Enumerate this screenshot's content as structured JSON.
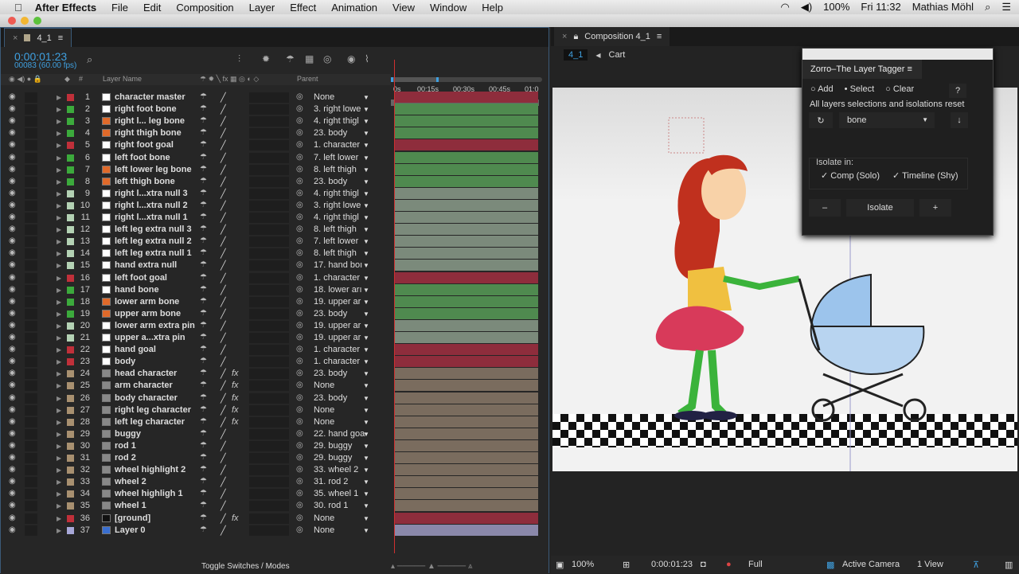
{
  "menubar": {
    "app": "After Effects",
    "items": [
      "File",
      "Edit",
      "Composition",
      "Layer",
      "Effect",
      "Animation",
      "View",
      "Window",
      "Help"
    ],
    "battery": "100%",
    "clock": "Fri 11:32",
    "user": "Mathias Möhl"
  },
  "timeline": {
    "tab": "4_1",
    "timecode": "0:00:01:23",
    "frames": "00083 (60.00 fps)",
    "columns": {
      "layer_name": "Layer Name",
      "parent": "Parent",
      "num": "#"
    },
    "ruler": [
      "0s",
      "00:15s",
      "00:30s",
      "00:45s",
      "01:0"
    ],
    "footer": "Toggle Switches / Modes",
    "colors": {
      "red": "#8e2d3c",
      "green": "#4f8a4f",
      "gray": "#7b8a7b",
      "tan": "#7a6c5e",
      "lavender": "#8a88aa"
    },
    "layers": [
      {
        "n": "1",
        "name": "character master",
        "lc": "#c0303a",
        "ic": "solid",
        "fx": false,
        "parent": "None",
        "bar": "red"
      },
      {
        "n": "2",
        "name": "right foot bone",
        "lc": "#3caa3c",
        "ic": "solid",
        "fx": false,
        "parent": "3. right lowe",
        "bar": "green"
      },
      {
        "n": "3",
        "name": "right l... leg bone",
        "lc": "#3caa3c",
        "ic": "bone",
        "fx": false,
        "parent": "4. right thigl",
        "bar": "green"
      },
      {
        "n": "4",
        "name": "right thigh bone",
        "lc": "#3caa3c",
        "ic": "bone",
        "fx": false,
        "parent": "23. body",
        "bar": "green"
      },
      {
        "n": "5",
        "name": "right foot goal",
        "lc": "#c0303a",
        "ic": "solid",
        "fx": false,
        "parent": "1. character",
        "bar": "red"
      },
      {
        "n": "6",
        "name": "left foot bone",
        "lc": "#3caa3c",
        "ic": "solid",
        "fx": false,
        "parent": "7. left lower",
        "bar": "green"
      },
      {
        "n": "7",
        "name": "left lower leg bone",
        "lc": "#3caa3c",
        "ic": "bone",
        "fx": false,
        "parent": "8. left thigh",
        "bar": "green"
      },
      {
        "n": "8",
        "name": "left thigh bone",
        "lc": "#3caa3c",
        "ic": "bone",
        "fx": false,
        "parent": "23. body",
        "bar": "green"
      },
      {
        "n": "9",
        "name": "right l...xtra null 3",
        "lc": "#b4d2b4",
        "ic": "solid",
        "fx": false,
        "parent": "4. right thigl",
        "bar": "gray"
      },
      {
        "n": "10",
        "name": "right l...xtra null 2",
        "lc": "#b4d2b4",
        "ic": "solid",
        "fx": false,
        "parent": "3. right lowe",
        "bar": "gray"
      },
      {
        "n": "11",
        "name": "right l...xtra null 1",
        "lc": "#b4d2b4",
        "ic": "solid",
        "fx": false,
        "parent": "4. right thigl",
        "bar": "gray"
      },
      {
        "n": "12",
        "name": "left leg extra null 3",
        "lc": "#b4d2b4",
        "ic": "solid",
        "fx": false,
        "parent": "8. left thigh",
        "bar": "gray"
      },
      {
        "n": "13",
        "name": "left leg extra null 2",
        "lc": "#b4d2b4",
        "ic": "solid",
        "fx": false,
        "parent": "7. left lower",
        "bar": "gray"
      },
      {
        "n": "14",
        "name": "left leg extra null 1",
        "lc": "#b4d2b4",
        "ic": "solid",
        "fx": false,
        "parent": "8. left thigh",
        "bar": "gray"
      },
      {
        "n": "15",
        "name": "hand extra null",
        "lc": "#b4d2b4",
        "ic": "solid",
        "fx": false,
        "parent": "17. hand boı",
        "bar": "gray"
      },
      {
        "n": "16",
        "name": "left foot goal",
        "lc": "#c0303a",
        "ic": "solid",
        "fx": false,
        "parent": "1. character",
        "bar": "red"
      },
      {
        "n": "17",
        "name": "hand bone",
        "lc": "#3caa3c",
        "ic": "solid",
        "fx": false,
        "parent": "18. lower arı",
        "bar": "green"
      },
      {
        "n": "18",
        "name": "lower arm bone",
        "lc": "#3caa3c",
        "ic": "bone",
        "fx": false,
        "parent": "19. upper ar",
        "bar": "green"
      },
      {
        "n": "19",
        "name": "upper arm bone",
        "lc": "#3caa3c",
        "ic": "bone",
        "fx": false,
        "parent": "23. body",
        "bar": "green"
      },
      {
        "n": "20",
        "name": "lower arm extra pin",
        "lc": "#b4d2b4",
        "ic": "solid",
        "fx": false,
        "parent": "19. upper ar",
        "bar": "gray"
      },
      {
        "n": "21",
        "name": "upper a...xtra pin",
        "lc": "#b4d2b4",
        "ic": "solid",
        "fx": false,
        "parent": "19. upper ar",
        "bar": "gray"
      },
      {
        "n": "22",
        "name": "hand goal",
        "lc": "#c0303a",
        "ic": "solid",
        "fx": false,
        "parent": "1. character",
        "bar": "red"
      },
      {
        "n": "23",
        "name": "body",
        "lc": "#c0303a",
        "ic": "solid",
        "fx": false,
        "parent": "1. character",
        "bar": "red"
      },
      {
        "n": "24",
        "name": "head character",
        "lc": "#a89070",
        "ic": "comp",
        "fx": true,
        "parent": "23. body",
        "bar": "tan"
      },
      {
        "n": "25",
        "name": "arm character",
        "lc": "#a89070",
        "ic": "comp",
        "fx": true,
        "parent": "None",
        "bar": "tan"
      },
      {
        "n": "26",
        "name": "body character",
        "lc": "#a89070",
        "ic": "comp",
        "fx": true,
        "parent": "23. body",
        "bar": "tan"
      },
      {
        "n": "27",
        "name": "right leg character",
        "lc": "#a89070",
        "ic": "comp",
        "fx": true,
        "parent": "None",
        "bar": "tan"
      },
      {
        "n": "28",
        "name": "left leg character",
        "lc": "#a89070",
        "ic": "comp",
        "fx": true,
        "parent": "None",
        "bar": "tan"
      },
      {
        "n": "29",
        "name": "buggy",
        "lc": "#a89070",
        "ic": "comp",
        "fx": false,
        "parent": "22. hand goa",
        "bar": "tan"
      },
      {
        "n": "30",
        "name": "rod 1",
        "lc": "#a89070",
        "ic": "comp",
        "fx": false,
        "parent": "29. buggy",
        "bar": "tan"
      },
      {
        "n": "31",
        "name": "rod 2",
        "lc": "#a89070",
        "ic": "comp",
        "fx": false,
        "parent": "29. buggy",
        "bar": "tan"
      },
      {
        "n": "32",
        "name": "wheel highlight 2",
        "lc": "#a89070",
        "ic": "comp",
        "fx": false,
        "parent": "33. wheel 2",
        "bar": "tan"
      },
      {
        "n": "33",
        "name": "wheel 2",
        "lc": "#a89070",
        "ic": "comp",
        "fx": false,
        "parent": "31. rod 2",
        "bar": "tan"
      },
      {
        "n": "34",
        "name": "wheel highligh 1",
        "lc": "#a89070",
        "ic": "comp",
        "fx": false,
        "parent": "35. wheel 1",
        "bar": "tan"
      },
      {
        "n": "35",
        "name": "wheel 1",
        "lc": "#a89070",
        "ic": "comp",
        "fx": false,
        "parent": "30. rod 1",
        "bar": "tan"
      },
      {
        "n": "36",
        "name": "[ground]",
        "lc": "#c0303a",
        "ic": "black",
        "fx": true,
        "parent": "None",
        "bar": "red"
      },
      {
        "n": "37",
        "name": "Layer 0",
        "lc": "#a8a8d8",
        "ic": "layer",
        "fx": false,
        "parent": "None",
        "bar": "lavender"
      }
    ]
  },
  "composition": {
    "tab": "Composition 4_1",
    "breadcrumb_current": "4_1",
    "breadcrumb_parent": "Cart",
    "footer": {
      "zoom": "100%",
      "timecode": "0:00:01:23",
      "resolution": "Full",
      "camera": "Active Camera",
      "views": "1 View"
    }
  },
  "zorro": {
    "title": "Zorro–The Layer Tagger",
    "modes": [
      "Add",
      "Select",
      "Clear"
    ],
    "selected_mode": "Select",
    "help": "?",
    "status": "All layers selections and isolations reset",
    "tag": "bone",
    "isolate_label": "Isolate in:",
    "comp_solo": "Comp (Solo)",
    "timeline_shy": "Timeline (Shy)",
    "minus": "–",
    "isolate": "Isolate",
    "plus": "+"
  }
}
